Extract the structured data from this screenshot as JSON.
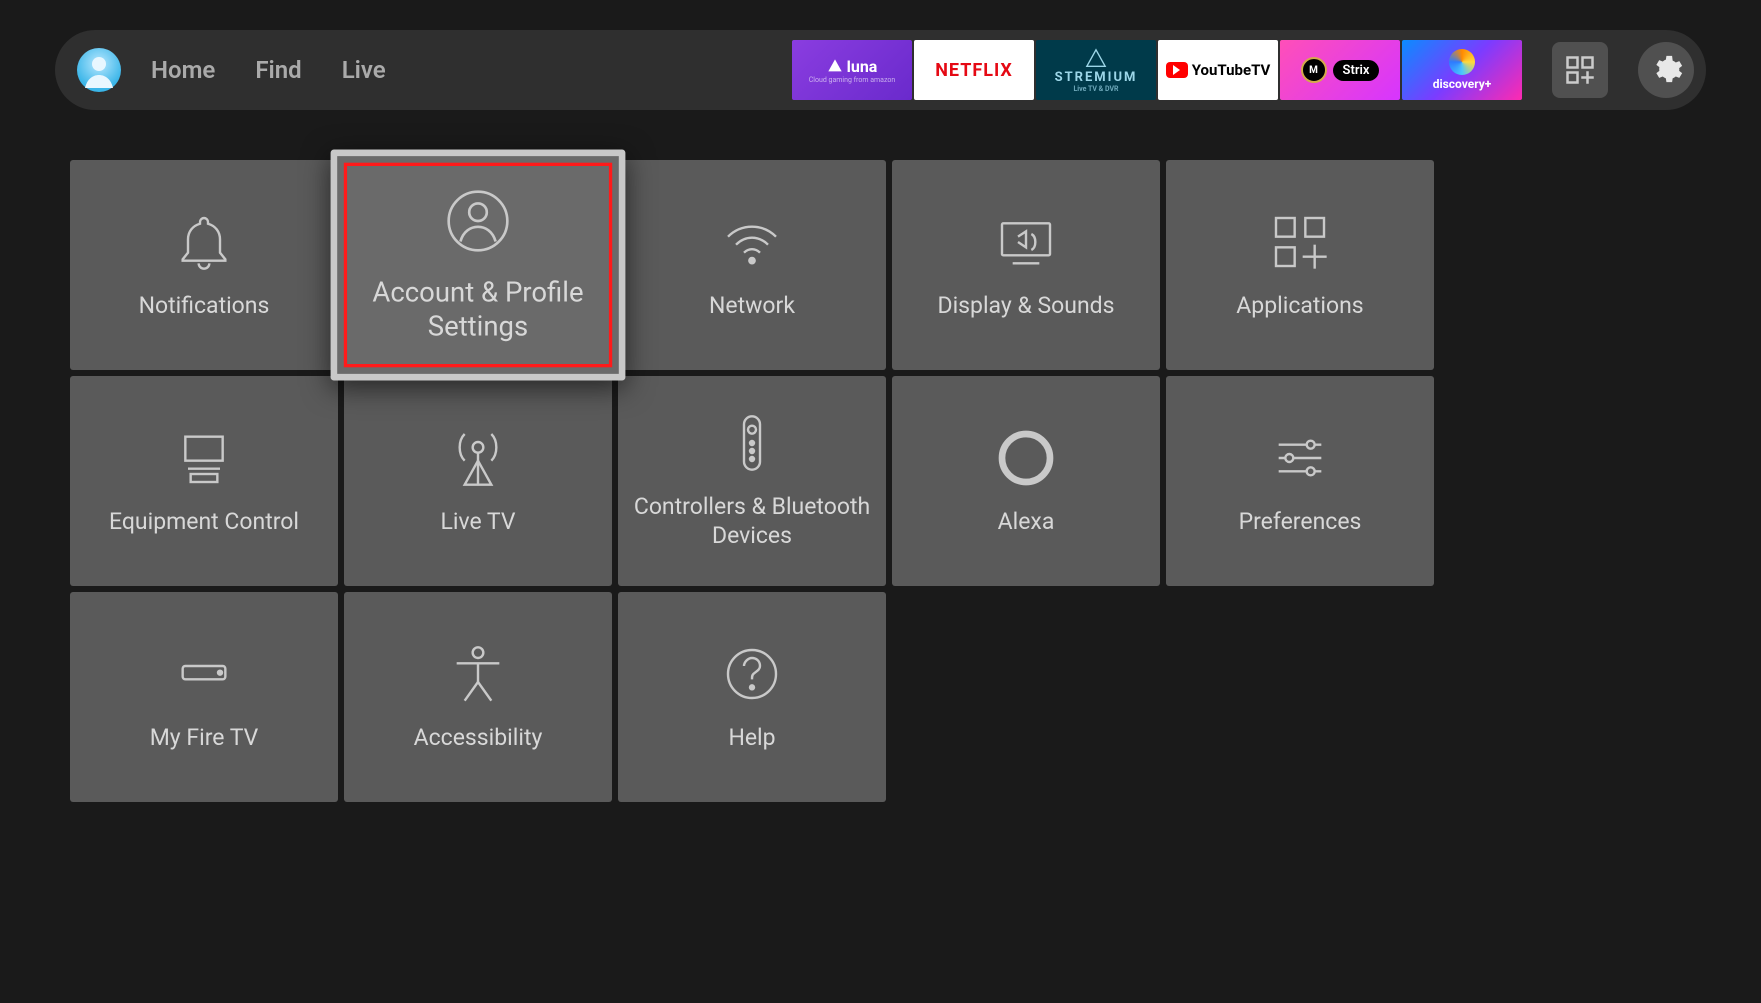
{
  "nav": {
    "links": [
      "Home",
      "Find",
      "Live"
    ]
  },
  "apps": {
    "luna": "luna",
    "netflix": "NETFLIX",
    "stremium": "STREMIUM",
    "stremium_sub": "Live TV & DVR",
    "youtubetv": "YouTubeTV",
    "strix": "Strix",
    "discovery": "discovery+"
  },
  "settings": {
    "tiles": [
      {
        "id": "notifications",
        "label": "Notifications",
        "icon": "bell",
        "selected": false
      },
      {
        "id": "account",
        "label": "Account & Profile Settings",
        "icon": "person",
        "selected": true
      },
      {
        "id": "network",
        "label": "Network",
        "icon": "wifi",
        "selected": false
      },
      {
        "id": "display",
        "label": "Display & Sounds",
        "icon": "display",
        "selected": false
      },
      {
        "id": "applications",
        "label": "Applications",
        "icon": "apps",
        "selected": false
      },
      {
        "id": "equipment",
        "label": "Equipment Control",
        "icon": "equipment",
        "selected": false
      },
      {
        "id": "livetv",
        "label": "Live TV",
        "icon": "antenna",
        "selected": false
      },
      {
        "id": "controllers",
        "label": "Controllers & Bluetooth Devices",
        "icon": "remote",
        "selected": false
      },
      {
        "id": "alexa",
        "label": "Alexa",
        "icon": "alexa",
        "selected": false
      },
      {
        "id": "preferences",
        "label": "Preferences",
        "icon": "sliders",
        "selected": false
      },
      {
        "id": "myfiretv",
        "label": "My Fire TV",
        "icon": "firetv",
        "selected": false
      },
      {
        "id": "accessibility",
        "label": "Accessibility",
        "icon": "accessibility",
        "selected": false
      },
      {
        "id": "help",
        "label": "Help",
        "icon": "help",
        "selected": false
      }
    ]
  }
}
